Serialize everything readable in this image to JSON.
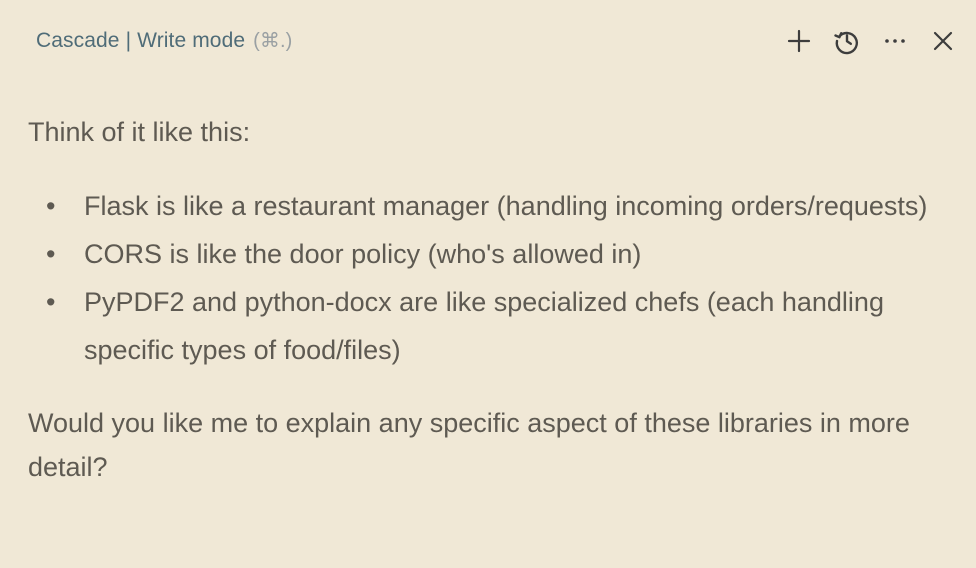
{
  "header": {
    "app_name": "Cascade",
    "separator": "|",
    "mode": "Write mode",
    "shortcut": "(⌘.)",
    "actions": [
      {
        "name": "new-chat",
        "icon": "plus-icon"
      },
      {
        "name": "history",
        "icon": "history-icon"
      },
      {
        "name": "more",
        "icon": "more-horizontal-icon"
      },
      {
        "name": "close",
        "icon": "close-icon"
      }
    ]
  },
  "message": {
    "intro": "Think of it like this:",
    "bullets": [
      "Flask is like a restaurant manager (handling incoming orders/requests)",
      "CORS is like the door policy (who's allowed in)",
      "PyPDF2 and python-docx are like specialized chefs (each handling specific types of food/files)"
    ],
    "outro": "Would you like me to explain any specific aspect of these libraries in more detail?"
  },
  "colors": {
    "background": "#f0e8d6",
    "title": "#4f6c78",
    "text": "#5e5a52",
    "icon": "#3d3d3d"
  }
}
